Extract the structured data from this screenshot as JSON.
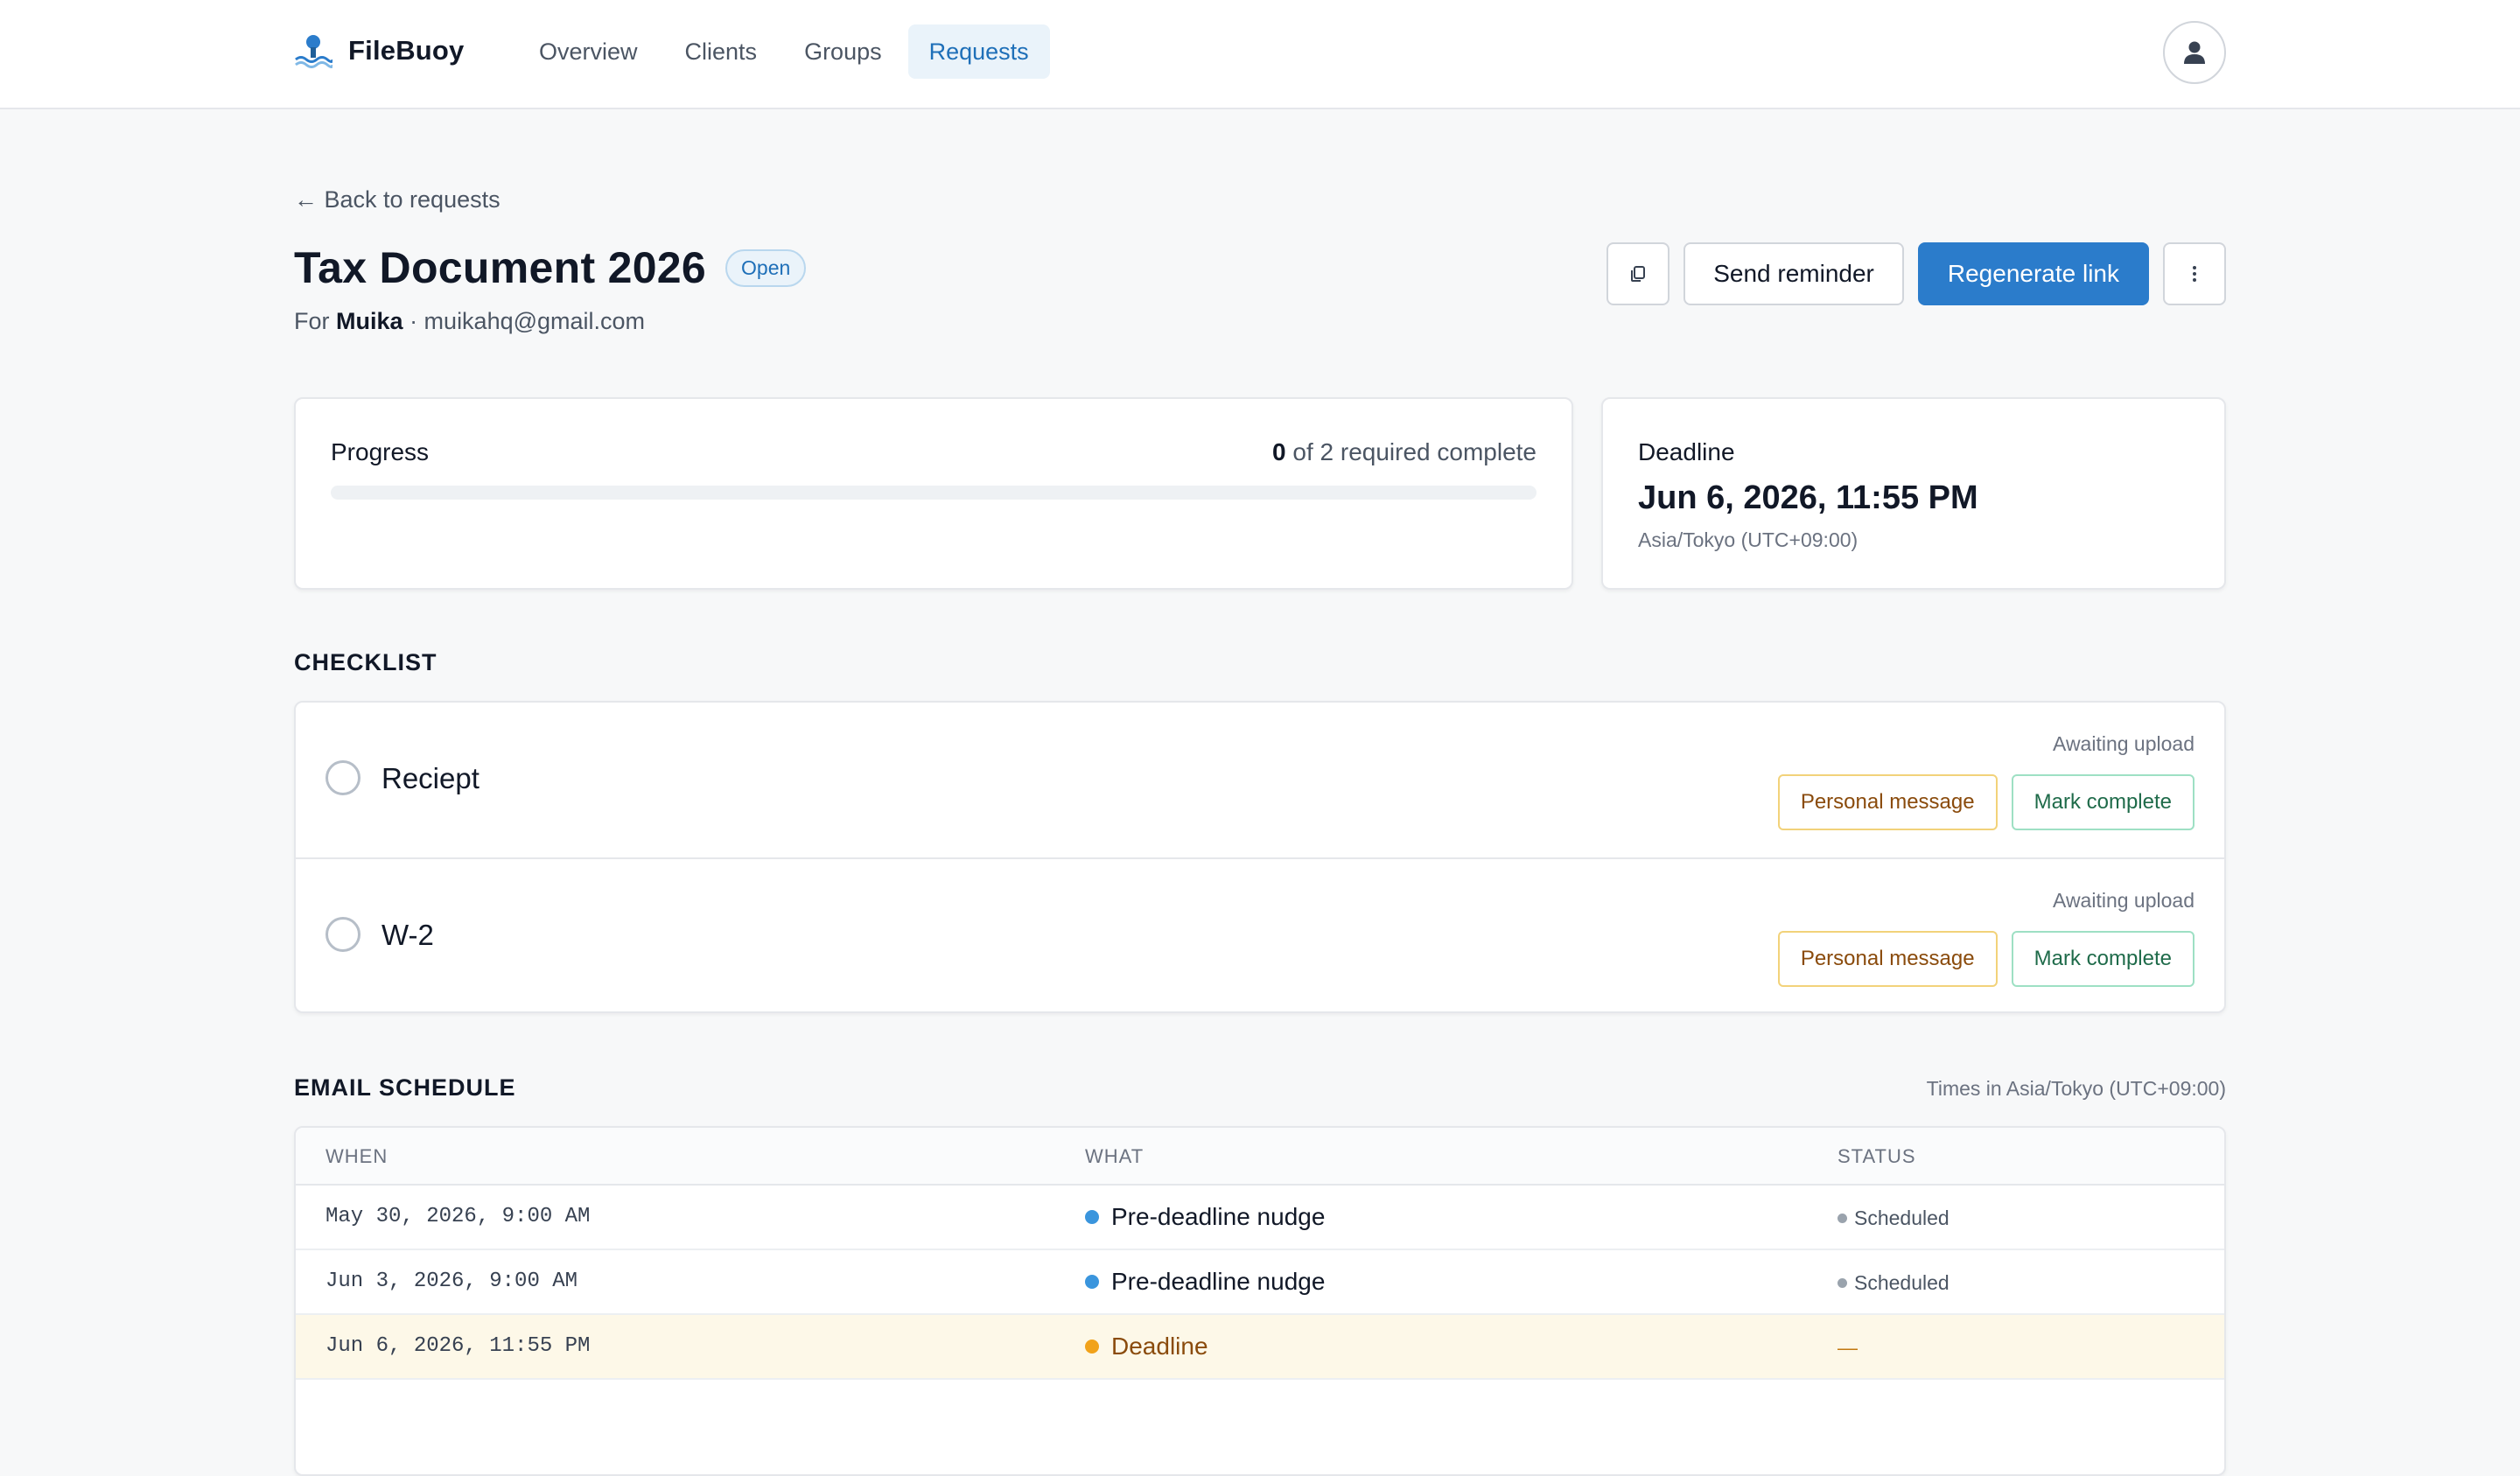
{
  "app": {
    "name": "FileBuoy"
  },
  "nav": {
    "items": [
      {
        "label": "Overview",
        "active": false
      },
      {
        "label": "Clients",
        "active": false
      },
      {
        "label": "Groups",
        "active": false
      },
      {
        "label": "Requests",
        "active": true
      }
    ]
  },
  "page": {
    "back_label": "← Back to requests",
    "title": "Tax Document 2026",
    "status": "Open",
    "for_prefix": "For",
    "client_name": "Muika",
    "client_email": "· muikahq@gmail.com"
  },
  "actions": {
    "copy_icon": "copy-icon",
    "send_reminder": "Send reminder",
    "regenerate_link": "Regenerate link",
    "more_icon": "more-vertical-icon"
  },
  "progress": {
    "label": "Progress",
    "done": "0",
    "summary_suffix": "of 2 required complete",
    "fraction": 0
  },
  "deadline": {
    "label": "Deadline",
    "value": "Jun 6, 2026, 11:55 PM",
    "timezone": "Asia/Tokyo (UTC+09:00)"
  },
  "checklist": {
    "heading": "CHECKLIST",
    "items": [
      {
        "name": "Reciept",
        "status": "Awaiting upload",
        "message_label": "Personal message",
        "complete_label": "Mark complete"
      },
      {
        "name": "W-2",
        "status": "Awaiting upload",
        "message_label": "Personal message",
        "complete_label": "Mark complete"
      }
    ]
  },
  "schedule": {
    "heading": "EMAIL SCHEDULE",
    "timezone_note": "Times in Asia/Tokyo (UTC+09:00)",
    "columns": {
      "when": "WHEN",
      "what": "WHAT",
      "status": "STATUS"
    },
    "rows": [
      {
        "when": "May 30, 2026, 9:00 AM",
        "what": "Pre-deadline nudge",
        "status": "Scheduled"
      },
      {
        "when": "Jun 3, 2026, 9:00 AM",
        "what": "Pre-deadline nudge",
        "status": "Scheduled"
      },
      {
        "when": "Jun 6, 2026, 11:55 PM",
        "what": "Deadline",
        "status": "—"
      }
    ]
  },
  "colors": {
    "accent": "#2b7ccb",
    "nav_active_bg": "#eaf3fa",
    "nudge_dot": "#3a95dd",
    "deadline_dot": "#f1a21a",
    "deadline_row_bg": "#fdf8e8"
  }
}
